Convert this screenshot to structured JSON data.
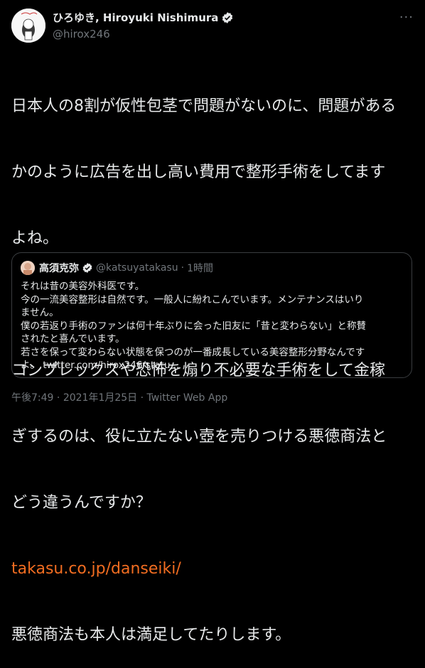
{
  "author": {
    "display_name": "ひろゆき, Hiroyuki Nishimura",
    "handle": "@hirox246"
  },
  "more_menu": "···",
  "tweet": {
    "lines": [
      "日本人の8割が仮性包茎で問題がないのに、問題がある",
      "かのように広告を出し高い費用で整形手術をしてます",
      "よね。",
      "",
      "コンプレックスや恐怖を煽り不必要な手術をして金稼",
      "ぎするのは、役に立たない壺を売りつける悪徳商法と",
      "どう違うんですか？"
    ],
    "link": "takasu.co.jp/danseiki/",
    "last_line": "悪徳商法も本人は満足してたりします。"
  },
  "quote": {
    "name": "高須克弥",
    "handle": "@katsuyatakasu",
    "separator": "·",
    "time": "1時間",
    "lines": [
      "それは昔の美容外科医です。",
      "今の一流美容整形は自然です。一般人に紛れこんでいます。メンテナンスはいり",
      "ません。",
      "僕の若返り手術のファンは何十年ぶりに会った旧友に「昔と変わらない」と称賛",
      "されたと喜んでいます。",
      "若さを保って変わらない状態を保つのが一番成長している美容整形分野なんです",
      "よ。 twitter.com/hirox246/statu..."
    ]
  },
  "footer": {
    "time": "午後7:49",
    "date": "2021年1月25日",
    "app": "Twitter Web App",
    "sep1": "·",
    "sep2": "·"
  },
  "colors": {
    "background": "#000000",
    "text": "#e7e9ea",
    "muted": "#71767b",
    "link": "#f26d21",
    "verified": "#e7e9ea"
  }
}
